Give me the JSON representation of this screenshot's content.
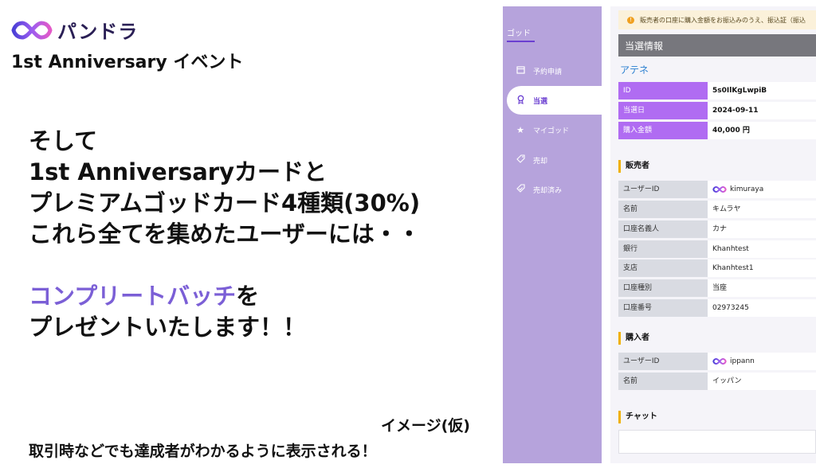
{
  "brand": {
    "logo_icon": "infinity-logo-icon",
    "name": "パンドラ"
  },
  "event_title": "1st Anniversary イベント",
  "headline": {
    "lines": [
      "そして",
      "1st Anniversaryカードと",
      "プレミアムゴッドカード4種類(30%)",
      "これら全てを集めたユーザーには・・"
    ],
    "accent_text": "コンプリートバッチ",
    "accent_suffix": "を",
    "last_line": "プレゼントいたします！！",
    "accent_color": "#7b5fd6"
  },
  "image_note": "イメージ(仮)",
  "footer_note": "取引時などでも達成者がわかるように表示される！",
  "sidebar": {
    "title": "ゴッド",
    "items": [
      {
        "label": "予約申請",
        "icon": "calendar-icon",
        "active": false
      },
      {
        "label": "当選",
        "icon": "award-icon",
        "active": true
      },
      {
        "label": "マイゴッド",
        "icon": "star-icon",
        "active": false
      },
      {
        "label": "売却",
        "icon": "tag-icon",
        "active": false
      },
      {
        "label": "売却済み",
        "icon": "tag-check-icon",
        "active": false
      }
    ]
  },
  "notice": "販売者の口座に購入金額をお振込みのうえ、振込証（振込",
  "win_info": {
    "header": "当選情報",
    "prize_name": "アテネ",
    "rows": [
      {
        "k": "ID",
        "v": "5s0IlKgLwpiB"
      },
      {
        "k": "当選日",
        "v": "2024-09-11"
      },
      {
        "k": "購入金額",
        "v": "40,000 円"
      }
    ]
  },
  "seller": {
    "title": "販売者",
    "rows": [
      {
        "k": "ユーザーID",
        "v": "kimuraya",
        "badge": "complete-badge-icon"
      },
      {
        "k": "名前",
        "v": "キムラヤ"
      },
      {
        "k": "口座名義人",
        "v": "カナ"
      },
      {
        "k": "銀行",
        "v": "Khanhtest"
      },
      {
        "k": "支店",
        "v": "Khanhtest1"
      },
      {
        "k": "口座種別",
        "v": "当座"
      },
      {
        "k": "口座番号",
        "v": "02973245"
      }
    ]
  },
  "buyer": {
    "title": "購入者",
    "rows": [
      {
        "k": "ユーザーID",
        "v": "ippann",
        "badge": "complete-badge-icon"
      },
      {
        "k": "名前",
        "v": "イッパン"
      }
    ]
  },
  "chat": {
    "title": "チャット"
  }
}
